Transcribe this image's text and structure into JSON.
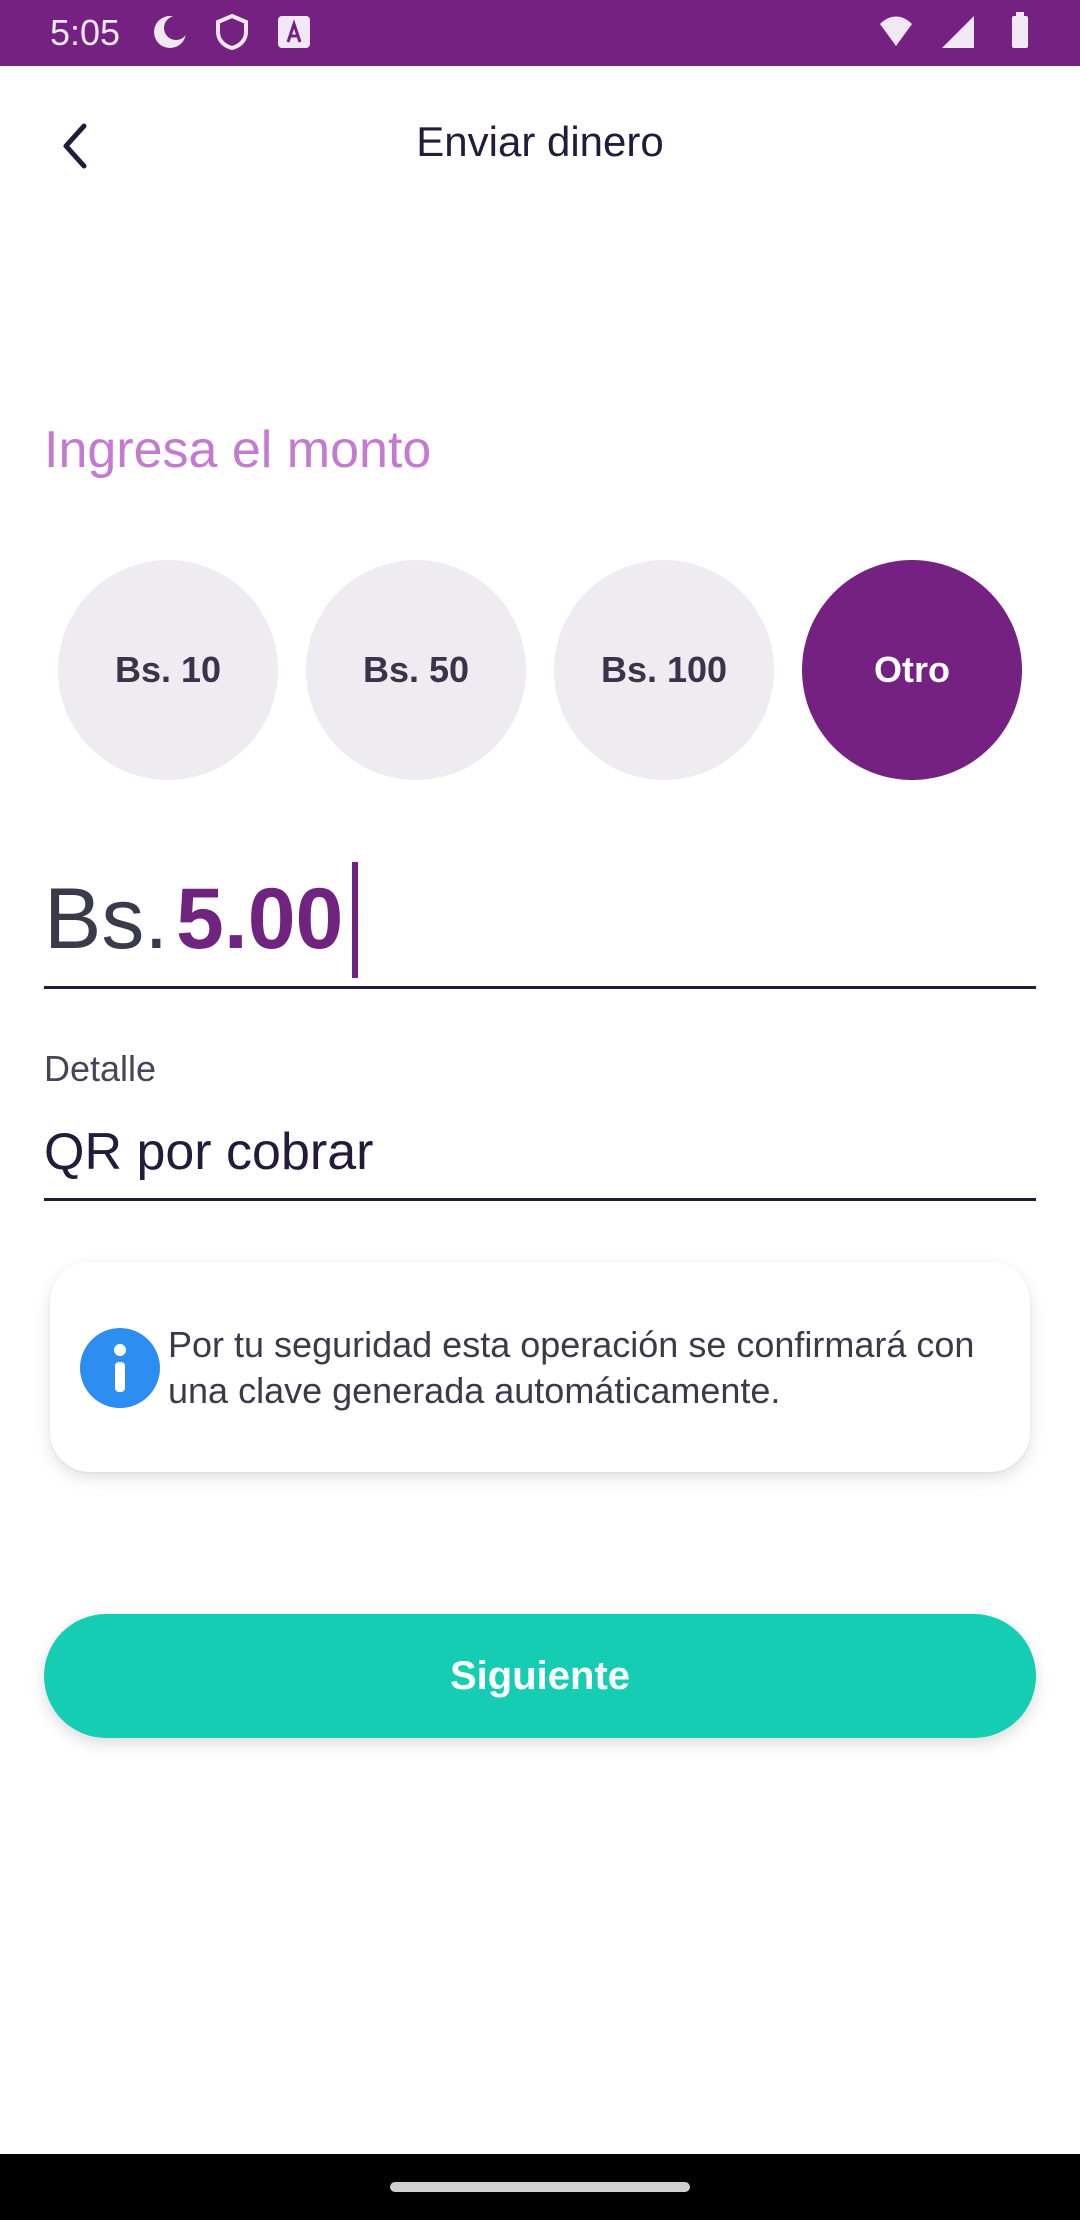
{
  "status_bar": {
    "time": "5:05",
    "icons_left": [
      "moon-icon",
      "shield-icon",
      "font-icon"
    ],
    "icons_right": [
      "wifi-icon",
      "signal-icon",
      "battery-icon"
    ],
    "color": "#742181"
  },
  "header": {
    "title": "Enviar dinero",
    "back_icon": "chevron-left-icon"
  },
  "amount_section": {
    "label": "Ingresa el monto",
    "options": [
      {
        "label": "Bs. 10",
        "selected": false
      },
      {
        "label": "Bs. 50",
        "selected": false
      },
      {
        "label": "Bs. 100",
        "selected": false
      },
      {
        "label": "Otro",
        "selected": true
      }
    ],
    "currency": "Bs.",
    "value": "5.00"
  },
  "detail": {
    "label": "Detalle",
    "value": "QR por cobrar"
  },
  "info": {
    "icon": "info-icon",
    "text": "Por tu seguridad esta operación se confirmará con una clave generada automáticamente."
  },
  "actions": {
    "next_label": "Siguiente",
    "accent": "#14cdb3"
  }
}
